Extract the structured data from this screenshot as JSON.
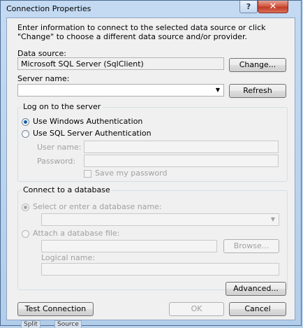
{
  "window": {
    "title": "Connection Properties",
    "help_label": "?",
    "close_label": "✕"
  },
  "intro_text": "Enter information to connect to the selected data source or click \"Change\" to choose a different data source and/or provider.",
  "data_source": {
    "label": "Data source:",
    "value": "Microsoft SQL Server (SqlClient)",
    "change_button": "Change..."
  },
  "server": {
    "label": "Server name:",
    "value": "",
    "refresh_button": "Refresh"
  },
  "logon": {
    "group_title": "Log on to the server",
    "windows_auth": "Use Windows Authentication",
    "sql_auth": "Use SQL Server Authentication",
    "selected": "windows",
    "user_name_label": "User name:",
    "password_label": "Password:",
    "save_password_label": "Save my password"
  },
  "database": {
    "group_title": "Connect to a database",
    "select_option": "Select or enter a database name:",
    "attach_option": "Attach a database file:",
    "browse_button": "Browse...",
    "logical_name_label": "Logical name:"
  },
  "buttons": {
    "advanced": "Advanced...",
    "test_connection": "Test Connection",
    "ok": "OK",
    "cancel": "Cancel"
  },
  "taskbar_tabs": [
    "Split",
    "Source"
  ]
}
